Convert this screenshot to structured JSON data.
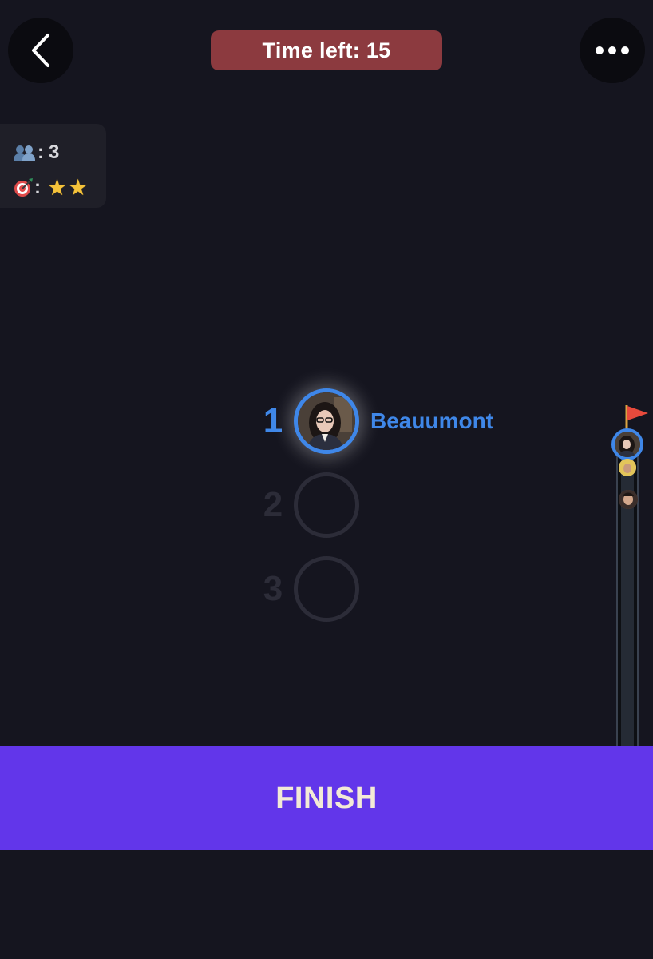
{
  "header": {
    "timer_text": "Time left: 15"
  },
  "info": {
    "players_count": "3",
    "colon": ":",
    "difficulty_stars": 2,
    "star_glyph": "★"
  },
  "ranking": [
    {
      "rank": "1",
      "name": "Beauumont",
      "filled": true
    },
    {
      "rank": "2",
      "name": "",
      "filled": false
    },
    {
      "rank": "3",
      "name": "",
      "filled": false
    }
  ],
  "footer": {
    "finish_label": "FINISH"
  },
  "colors": {
    "background": "#15151f",
    "accent_blue": "#3f87e8",
    "timer_bg": "#8c3a3f",
    "finish_bg": "#6236ea",
    "finish_text": "#f3ead6",
    "rank_inactive": "#2c2c38"
  },
  "icons": {
    "back": "chevron-left-icon",
    "menu": "more-horizontal-icon",
    "players": "people-icon",
    "target": "dartboard-icon",
    "flag": "flag-icon"
  }
}
